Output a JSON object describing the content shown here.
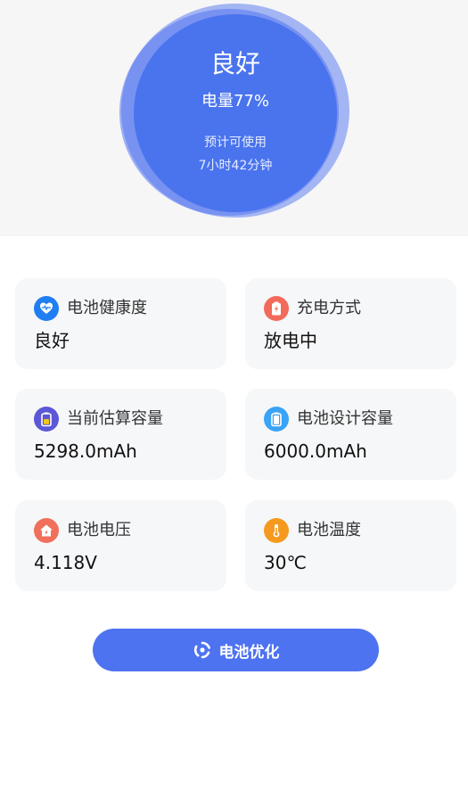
{
  "battery": {
    "status": "良好",
    "level_text": "电量77%",
    "level_percent": 77,
    "estimate_label": "预计可使用",
    "estimate_value": "7小时42分钟"
  },
  "cards": [
    {
      "title": "电池健康度",
      "value": "良好",
      "icon": "health-icon",
      "color": "#1f7ef3"
    },
    {
      "title": "充电方式",
      "value": "放电中",
      "icon": "charge-icon",
      "color": "#f26a5a"
    },
    {
      "title": "当前估算容量",
      "value": "5298.0mAh",
      "icon": "capacity-icon",
      "color": "#5b57d6"
    },
    {
      "title": "电池设计容量",
      "value": "6000.0mAh",
      "icon": "design-capacity-icon",
      "color": "#3aa3f5"
    },
    {
      "title": "电池电压",
      "value": "4.118V",
      "icon": "voltage-icon",
      "color": "#f0705c"
    },
    {
      "title": "电池温度",
      "value": "30℃",
      "icon": "thermometer-icon",
      "color": "#f59a1f"
    }
  ],
  "optimize_button": {
    "label": "电池优化",
    "icon": "optimize-icon"
  },
  "colors": {
    "primary": "#4a74ee",
    "button": "#4d73f1",
    "card_bg": "#f6f7f9"
  }
}
